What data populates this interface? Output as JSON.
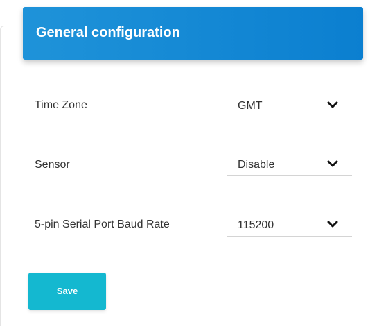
{
  "header": {
    "title": "General configuration"
  },
  "settings": [
    {
      "label": "Time Zone",
      "value": "GMT",
      "icon": "chevron-down-icon"
    },
    {
      "label": "Sensor",
      "value": "Disable",
      "icon": "chevron-down-icon"
    },
    {
      "label": "5-pin Serial Port Baud Rate",
      "value": "115200",
      "icon": "chevron-down-icon"
    }
  ],
  "actions": {
    "save_label": "Save"
  },
  "colors": {
    "header_bg": "#1289d6",
    "save_bg": "#14b8d0"
  }
}
